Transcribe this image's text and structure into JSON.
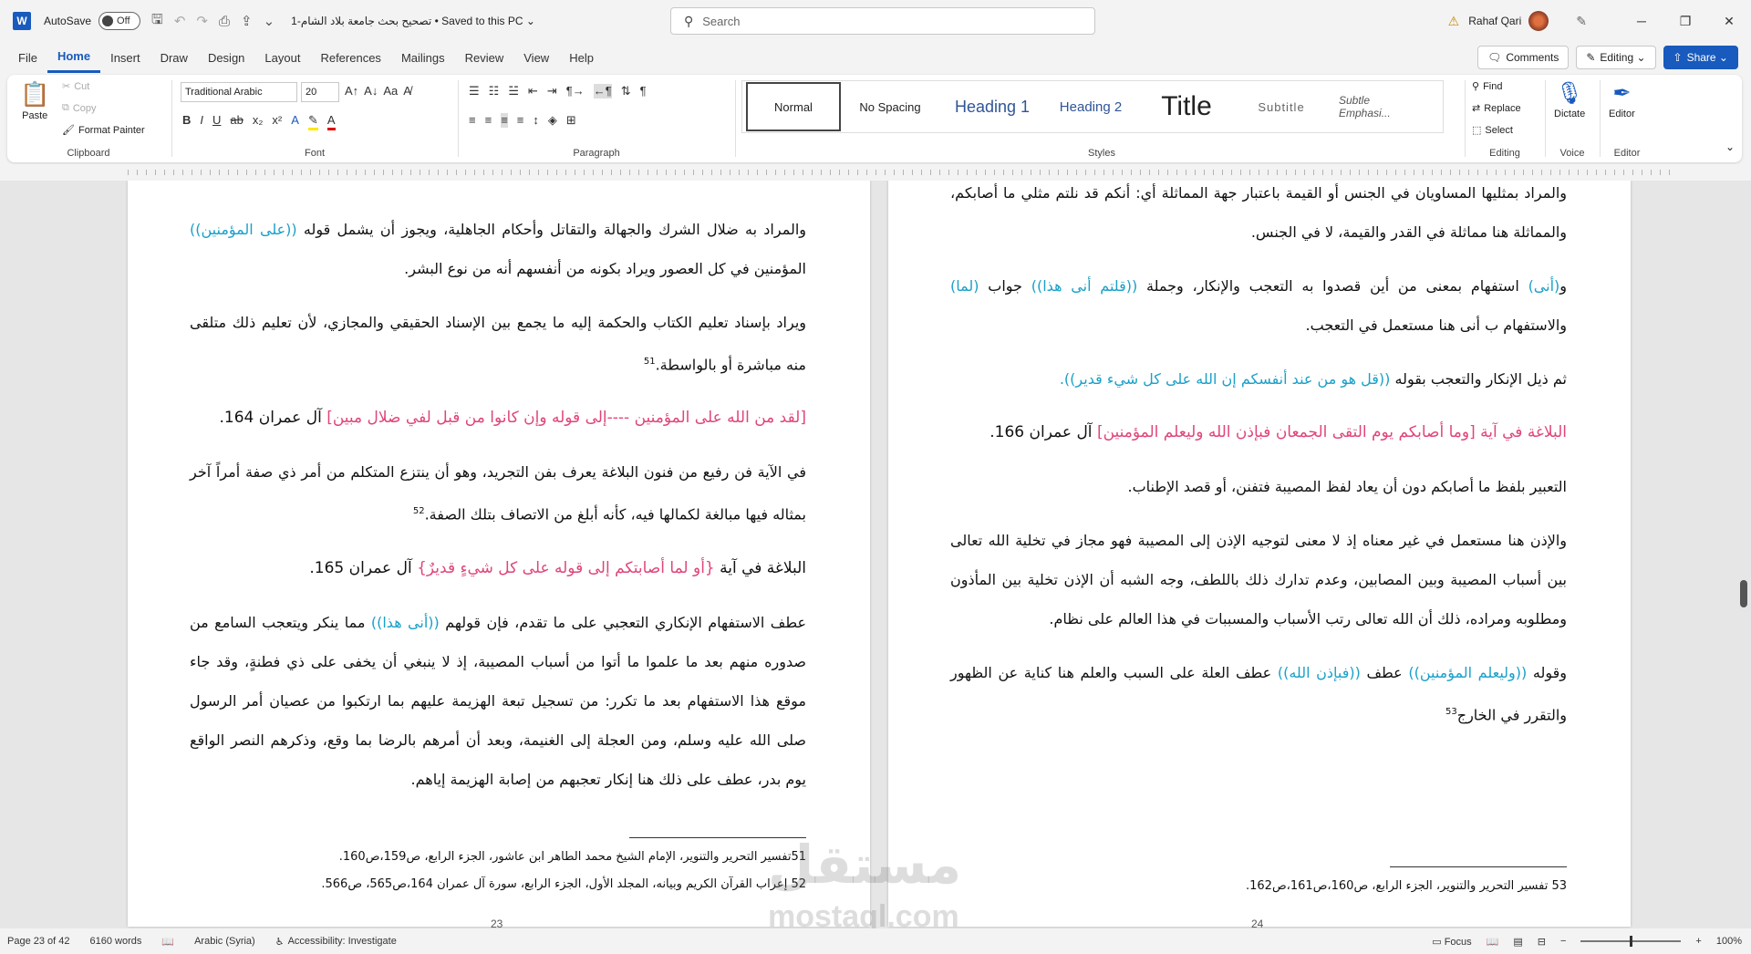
{
  "titlebar": {
    "logo": "W",
    "autosave_label": "AutoSave",
    "autosave_state": "Off",
    "doc_title": "تصحيح بحث جامعة بلاد الشام-1 • Saved to this PC ⌄",
    "search_placeholder": "Search",
    "user_name": "Rahaf Qari"
  },
  "menu": {
    "tabs": [
      "File",
      "Home",
      "Insert",
      "Draw",
      "Design",
      "Layout",
      "References",
      "Mailings",
      "Review",
      "View",
      "Help"
    ],
    "comments": "Comments",
    "editing": "Editing ⌄",
    "share": "Share ⌄"
  },
  "ribbon": {
    "clipboard": {
      "label": "Clipboard",
      "paste": "Paste",
      "cut": "Cut",
      "copy": "Copy",
      "format_painter": "Format Painter"
    },
    "font": {
      "label": "Font",
      "family": "Traditional Arabic",
      "size": "20"
    },
    "paragraph": {
      "label": "Paragraph"
    },
    "styles": {
      "label": "Styles",
      "items": [
        "Normal",
        "No Spacing",
        "Heading 1",
        "Heading 2",
        "Title",
        "Subtitle",
        "Subtle Emphasi..."
      ]
    },
    "editing": {
      "label": "Editing",
      "find": "Find",
      "replace": "Replace",
      "select": "Select"
    },
    "voice": {
      "label": "Voice",
      "dictate": "Dictate"
    },
    "editor": {
      "label": "Editor",
      "editor": "Editor"
    }
  },
  "left_page": {
    "number": "23",
    "p1a": "والمراد به ضلال الشرك والجهالة والتقاتل وأحكام الجاهلية، ويجوز أن يشمل قوله ",
    "p1b": "((على المؤمنين))",
    "p1c": " المؤمنين في كل العصور ويراد بكونه من أنفسهم أنه من نوع البشر.",
    "p2": "ويراد بإسناد تعليم الكتاب والحكمة إليه ما يجمع بين الإسناد الحقيقي والمجازي، لأن تعليم ذلك متلقى منه مباشرة أو بالواسطة.",
    "p2_fn": "51",
    "p3a": "[لقد من الله على المؤمنين ----إلى قوله وإن كانوا من قبل لفي ضلال مبين]",
    "p3b": " آل عمران 164.",
    "p4": "في الآية فن رفيع من فنون البلاغة يعرف بفن التجريد، وهو أن ينتزع المتكلم من أمر ذي صفة أمراً آخر بمثاله فيها مبالغة لكمالها فيه، كأنه أبلغ من الاتصاف بتلك الصفة.",
    "p4_fn": "52",
    "p5a": "البلاغة في آية ",
    "p5b": "{أو لما أصابتكم إلى قوله على كل شيءٍ قديرٌ}",
    "p5c": " آل عمران 165.",
    "p6a": "عطف الاستفهام الإنكاري التعجبي على ما تقدم، فإن قولهم ",
    "p6b": "((أنى هذا))",
    "p6c": " مما ينكر ويتعجب السامع من صدوره منهم بعد ما علموا ما أتوا من أسباب المصيبة، إذ لا ينبغي أن يخفى على ذي فطنةٍ، وقد جاء موقع هذا الاستفهام بعد ما تكرر: من تسجيل تبعة الهزيمة عليهم بما ارتكبوا من عصيان أمر الرسول صلى الله عليه وسلم، ومن العجلة إلى الغنيمة، وبعد أن أمرهم بالرضا بما وقع، وذكرهم النصر الواقع يوم بدر، عطف على ذلك هنا إنكار تعجبهم من إصابة الهزيمة إياهم.",
    "fn1": "51تفسير التحرير والتنوير، الإمام الشيخ محمد الطاهر ابن عاشور، الجزء الرابع، ص159،ص160.",
    "fn2": "52 إعراب القرآن الكريم وبيانه، المجلد الأول، الجزء الرابع، سورة آل عمران 164،ص565، ص566."
  },
  "right_page": {
    "number": "24",
    "p0": "والمراد بمثليها المساويان في الجنس أو القيمة باعتبار جهة المماثلة أي: أنكم قد نلتم مثلي ما أصابكم، والمماثلة هنا مماثلة في القدر والقيمة، لا في الجنس.",
    "p1a": "و",
    "p1b": "(أنى)",
    "p1c": " استفهام بمعنى من أين قصدوا به التعجب والإنكار، وجملة ",
    "p1d": "((قلتم أنى هذا))",
    "p1e": " جواب ",
    "p1f": "(لما)",
    "p1g": " والاستفهام ب أنى هنا مستعمل في التعجب.",
    "p2a": "ثم ذيل الإنكار والتعجب بقوله ",
    "p2b": "((قل هو من عند أنفسكم إن الله على كل شيء قدير)).",
    "p3a": "البلاغة في آية [وما أصابكم يوم التقى الجمعان فبإذن الله وليعلم المؤمنين]",
    "p3b": " آل عمران 166.",
    "p4": "التعبير بلفظ ما أصابكم دون أن يعاد لفظ المصيبة فتفنن، أو قصد الإطناب.",
    "p5": "والإذن هنا مستعمل في غير معناه إذ لا معنى لتوجيه الإذن إلى المصيبة فهو مجاز في تخلية الله تعالى بين أسباب المصيبة وبين المصابين، وعدم تدارك ذلك باللطف، وجه الشبه أن الإذن تخلية بين المأذون ومطلوبه ومراده، ذلك أن الله تعالى رتب الأسباب والمسببات في هذا العالم على نظام.",
    "p6a": "وقوله ",
    "p6b": "((وليعلم المؤمنين))",
    "p6c": " عطف ",
    "p6d": "((فبإذن الله))",
    "p6e": " عطف العلة على السبب والعلم هنا كناية عن الظهور والتقرر في الخارج",
    "p6_fn": "53",
    "fn1": "53 تفسير التحرير والتنوير، الجزء الرابع، ص160،ص161،ص162."
  },
  "watermark": {
    "line1": "مستقل",
    "line2": "mostaql.com"
  },
  "status": {
    "page": "Page 23 of 42",
    "words": "6160 words",
    "language": "Arabic (Syria)",
    "accessibility": "Accessibility: Investigate",
    "focus": "Focus",
    "zoom": "100%"
  },
  "colors": {
    "accent": "#185abd",
    "quran_cyan": "#1aa0c8",
    "quran_pink": "#e0457b"
  }
}
